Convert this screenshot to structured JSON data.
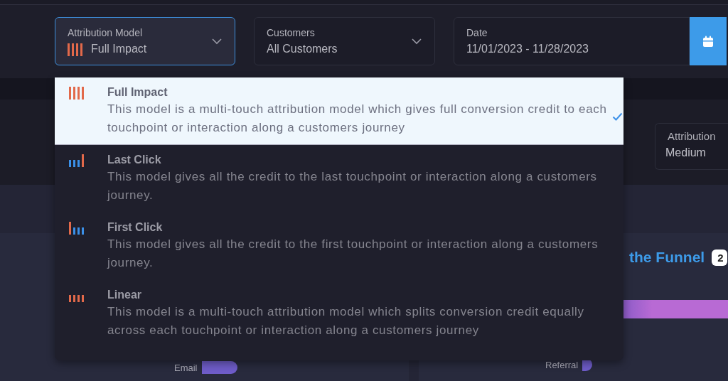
{
  "filters": [
    {
      "kind": "select",
      "label": "Attribution Model",
      "value": "Full Impact",
      "icon": {
        "kind": "full_impact"
      },
      "focused": true
    },
    {
      "kind": "select",
      "label": "Customers",
      "value": "All Customers",
      "focused": false
    },
    {
      "kind": "date",
      "label": "Date",
      "value": "11/01/2023 - 11/28/2023",
      "focused": false
    }
  ],
  "attribution_card": {
    "label": "Attribution",
    "value": "Medium"
  },
  "funnel_card": {
    "title": "the Funnel",
    "badge": "2"
  },
  "channels": [
    {
      "label": "Email"
    },
    {
      "label": "Referral"
    }
  ],
  "model_menu": {
    "options": [
      {
        "kind": "full_impact",
        "title": "Full Impact",
        "description": "This model is a multi-touch attribution model which gives full conversion credit to each touchpoint or interaction along a customers journey",
        "selected": true
      },
      {
        "kind": "last_click",
        "title": "Last Click",
        "description": "This model gives all the credit to the last touchpoint or interaction along a customers journey.",
        "selected": false
      },
      {
        "kind": "first_click",
        "title": "First Click",
        "description": "This model gives all the credit to the first touchpoint or interaction along a customers journey.",
        "selected": false
      },
      {
        "kind": "linear",
        "title": "Linear",
        "description": "This model is a multi-touch attribution model which splits conversion credit equally across each touchpoint or interaction along a customers journey",
        "selected": false
      }
    ]
  }
}
